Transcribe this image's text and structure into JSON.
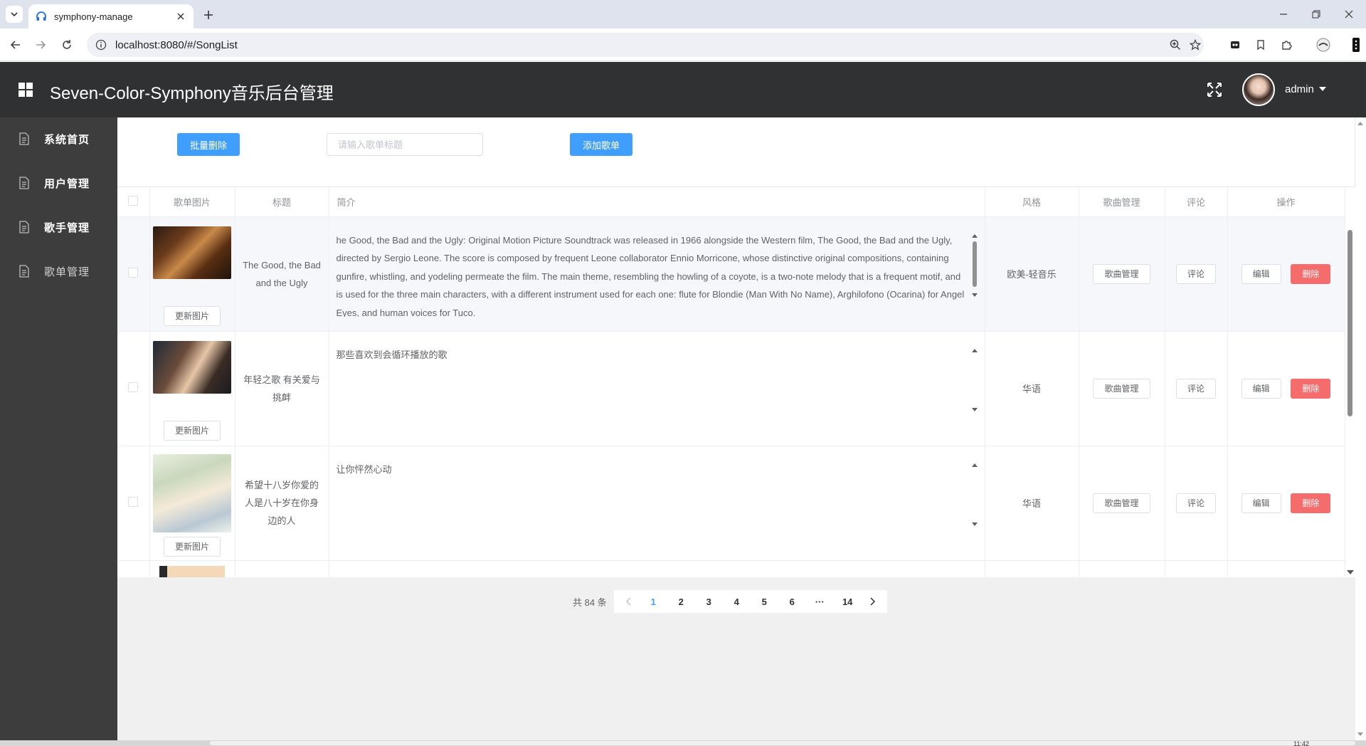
{
  "browser": {
    "tab_title": "symphony-manage",
    "url": "localhost:8080/#/SongList",
    "clock": "11:42"
  },
  "header": {
    "title": "Seven-Color-Symphony音乐后台管理",
    "user": "admin"
  },
  "sidebar": {
    "items": [
      {
        "label": "系统首页"
      },
      {
        "label": "用户管理"
      },
      {
        "label": "歌手管理"
      },
      {
        "label": "歌单管理"
      }
    ]
  },
  "toolbar": {
    "batch_delete": "批量删除",
    "search_placeholder": "请输入歌单标题",
    "add": "添加歌单"
  },
  "table": {
    "columns": [
      "歌单图片",
      "标题",
      "简介",
      "风格",
      "歌曲管理",
      "评论",
      "操作"
    ],
    "update_image": "更新图片",
    "song_manage": "歌曲管理",
    "comment": "评论",
    "edit": "编辑",
    "delete": "删除",
    "rows": [
      {
        "title": "The Good, the Bad and the Ugly",
        "intro": "he Good, the Bad and the Ugly: Original Motion Picture Soundtrack was released in 1966 alongside the Western film, The Good, the Bad and the Ugly, directed by Sergio Leone. The score is composed by frequent Leone collaborator Ennio Morricone, whose distinctive original compositions, containing gunfire, whistling, and yodeling permeate the film. The main theme, resembling the howling of a coyote, is a two-note melody that is a frequent motif, and is used for the three main characters, with a different instrument used for each one: flute for Blondie (Man With No Name), Arghilofono (Ocarina) for Angel Eyes, and human voices for Tuco.",
        "style": "欧美-轻音乐"
      },
      {
        "title": "年轻之歌 有关爱与挑衅",
        "intro": "那些喜欢到会循环播放的歌",
        "style": "华语"
      },
      {
        "title": "希望十八岁你爱的人是八十岁在你身边的人",
        "intro": "让你怦然心动",
        "style": "华语"
      }
    ]
  },
  "pagination": {
    "total_text": "共 84 条",
    "pages": [
      "1",
      "2",
      "3",
      "4",
      "5",
      "6",
      "···",
      "14"
    ],
    "current": "1"
  },
  "colors": {
    "header_bg": "#303133",
    "sidebar_bg": "#3d3d3d",
    "primary": "#409eff",
    "danger": "#f56c6c"
  }
}
